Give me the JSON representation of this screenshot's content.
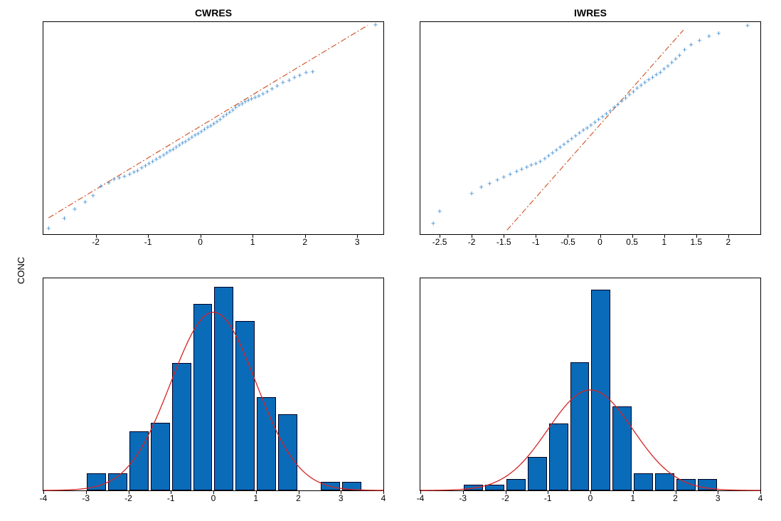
{
  "ylabel": "CONC",
  "panels": {
    "cwres": {
      "title": "CWRES"
    },
    "iwres": {
      "title": "IWRES"
    }
  },
  "chart_data": [
    {
      "id": "cwres_qq",
      "type": "scatter",
      "title": "CWRES",
      "xlim": [
        -3.0,
        3.5
      ],
      "ylim": [
        -3.0,
        3.5
      ],
      "xticks": [
        -2,
        -1,
        0,
        1,
        2,
        3
      ],
      "reference_line": {
        "x0": -2.9,
        "y0": -2.5,
        "x1": 3.2,
        "y1": 3.4,
        "style": "dash-dot",
        "color": "#d15a2e"
      },
      "points_color": "#3b8bcf",
      "points": [
        [
          -2.9,
          -2.85
        ],
        [
          -2.6,
          -2.55
        ],
        [
          -2.4,
          -2.25
        ],
        [
          -2.2,
          -2.05
        ],
        [
          -2.05,
          -1.85
        ],
        [
          -1.9,
          -1.55
        ],
        [
          -1.75,
          -1.45
        ],
        [
          -1.65,
          -1.35
        ],
        [
          -1.55,
          -1.3
        ],
        [
          -1.45,
          -1.25
        ],
        [
          -1.35,
          -1.2
        ],
        [
          -1.27,
          -1.13
        ],
        [
          -1.2,
          -1.07
        ],
        [
          -1.12,
          -1.0
        ],
        [
          -1.05,
          -0.93
        ],
        [
          -0.98,
          -0.87
        ],
        [
          -0.91,
          -0.8
        ],
        [
          -0.84,
          -0.73
        ],
        [
          -0.77,
          -0.67
        ],
        [
          -0.7,
          -0.6
        ],
        [
          -0.64,
          -0.54
        ],
        [
          -0.58,
          -0.48
        ],
        [
          -0.52,
          -0.42
        ],
        [
          -0.46,
          -0.36
        ],
        [
          -0.4,
          -0.3
        ],
        [
          -0.34,
          -0.24
        ],
        [
          -0.28,
          -0.18
        ],
        [
          -0.22,
          -0.12
        ],
        [
          -0.16,
          -0.06
        ],
        [
          -0.1,
          0.0
        ],
        [
          -0.04,
          0.06
        ],
        [
          0.02,
          0.12
        ],
        [
          0.08,
          0.18
        ],
        [
          0.14,
          0.24
        ],
        [
          0.2,
          0.3
        ],
        [
          0.26,
          0.36
        ],
        [
          0.32,
          0.43
        ],
        [
          0.38,
          0.5
        ],
        [
          0.44,
          0.57
        ],
        [
          0.5,
          0.64
        ],
        [
          0.56,
          0.71
        ],
        [
          0.62,
          0.78
        ],
        [
          0.68,
          0.85
        ],
        [
          0.74,
          0.92
        ],
        [
          0.8,
          0.98
        ],
        [
          0.86,
          1.03
        ],
        [
          0.92,
          1.08
        ],
        [
          0.98,
          1.12
        ],
        [
          1.05,
          1.17
        ],
        [
          1.12,
          1.22
        ],
        [
          1.2,
          1.28
        ],
        [
          1.28,
          1.35
        ],
        [
          1.37,
          1.43
        ],
        [
          1.47,
          1.52
        ],
        [
          1.58,
          1.62
        ],
        [
          1.7,
          1.7
        ],
        [
          1.8,
          1.78
        ],
        [
          1.9,
          1.85
        ],
        [
          2.02,
          1.92
        ],
        [
          2.15,
          1.95
        ],
        [
          3.35,
          3.4
        ]
      ]
    },
    {
      "id": "iwres_qq",
      "type": "scatter",
      "title": "IWRES",
      "xlim": [
        -2.8,
        2.5
      ],
      "ylim": [
        -2.8,
        2.5
      ],
      "xticks": [
        -2.5,
        -2,
        -1.5,
        -1,
        -0.5,
        0,
        0.5,
        1,
        1.5,
        2
      ],
      "reference_line": {
        "x0": -1.45,
        "y0": -2.7,
        "x1": 1.3,
        "y1": 2.3,
        "style": "dash-dot",
        "color": "#d15a2e"
      },
      "points_color": "#3b8bcf",
      "points": [
        [
          -2.6,
          -2.55
        ],
        [
          -2.5,
          -2.25
        ],
        [
          -2.0,
          -1.8
        ],
        [
          -1.85,
          -1.65
        ],
        [
          -1.72,
          -1.55
        ],
        [
          -1.6,
          -1.47
        ],
        [
          -1.5,
          -1.4
        ],
        [
          -1.4,
          -1.33
        ],
        [
          -1.3,
          -1.25
        ],
        [
          -1.22,
          -1.2
        ],
        [
          -1.14,
          -1.15
        ],
        [
          -1.07,
          -1.1
        ],
        [
          -1.0,
          -1.05
        ],
        [
          -0.93,
          -1.0
        ],
        [
          -0.86,
          -0.93
        ],
        [
          -0.8,
          -0.86
        ],
        [
          -0.74,
          -0.79
        ],
        [
          -0.68,
          -0.72
        ],
        [
          -0.62,
          -0.65
        ],
        [
          -0.56,
          -0.58
        ],
        [
          -0.5,
          -0.51
        ],
        [
          -0.44,
          -0.44
        ],
        [
          -0.38,
          -0.37
        ],
        [
          -0.32,
          -0.3
        ],
        [
          -0.26,
          -0.23
        ],
        [
          -0.2,
          -0.16
        ],
        [
          -0.14,
          -0.09
        ],
        [
          -0.08,
          -0.02
        ],
        [
          -0.02,
          0.05
        ],
        [
          0.04,
          0.12
        ],
        [
          0.1,
          0.19
        ],
        [
          0.16,
          0.26
        ],
        [
          0.22,
          0.34
        ],
        [
          0.28,
          0.42
        ],
        [
          0.34,
          0.5
        ],
        [
          0.4,
          0.58
        ],
        [
          0.46,
          0.66
        ],
        [
          0.52,
          0.74
        ],
        [
          0.58,
          0.82
        ],
        [
          0.64,
          0.9
        ],
        [
          0.7,
          0.97
        ],
        [
          0.76,
          1.04
        ],
        [
          0.82,
          1.1
        ],
        [
          0.88,
          1.16
        ],
        [
          0.94,
          1.22
        ],
        [
          1.0,
          1.3
        ],
        [
          1.06,
          1.38
        ],
        [
          1.12,
          1.46
        ],
        [
          1.18,
          1.55
        ],
        [
          1.24,
          1.65
        ],
        [
          1.32,
          1.78
        ],
        [
          1.42,
          1.92
        ],
        [
          1.55,
          2.02
        ],
        [
          1.7,
          2.12
        ],
        [
          1.85,
          2.2
        ],
        [
          2.3,
          2.4
        ]
      ]
    },
    {
      "id": "cwres_hist",
      "type": "bar",
      "title": "CWRES",
      "xlim": [
        -4,
        4
      ],
      "ylim": [
        0,
        25
      ],
      "xticks": [
        -4,
        -3,
        -2,
        -1,
        0,
        1,
        2,
        3,
        4
      ],
      "bin_width": 0.5,
      "categories": [
        -2.75,
        -2.25,
        -1.75,
        -1.25,
        -0.75,
        -0.25,
        0.25,
        0.75,
        1.25,
        1.75,
        2.75,
        3.25
      ],
      "values": [
        2,
        2,
        7,
        8,
        15,
        22,
        24,
        20,
        11,
        9,
        1,
        1
      ],
      "normal_curve": {
        "mu": 0.0,
        "sigma": 1.0,
        "peak_value": 21,
        "color": "#d42525"
      }
    },
    {
      "id": "iwres_hist",
      "type": "bar",
      "title": "IWRES",
      "xlim": [
        -4,
        4
      ],
      "ylim": [
        0,
        38
      ],
      "xticks": [
        -4,
        -3,
        -2,
        -1,
        0,
        1,
        2,
        3,
        4
      ],
      "bin_width": 0.5,
      "categories": [
        -2.75,
        -2.25,
        -1.75,
        -1.25,
        -0.75,
        -0.25,
        0.25,
        0.75,
        1.25,
        1.75,
        2.25,
        2.75
      ],
      "values": [
        1,
        1,
        2,
        6,
        12,
        23,
        36,
        15,
        3,
        3,
        2,
        2
      ],
      "normal_curve": {
        "mu": 0.0,
        "sigma": 1.0,
        "peak_value": 18,
        "color": "#d42525"
      }
    }
  ]
}
